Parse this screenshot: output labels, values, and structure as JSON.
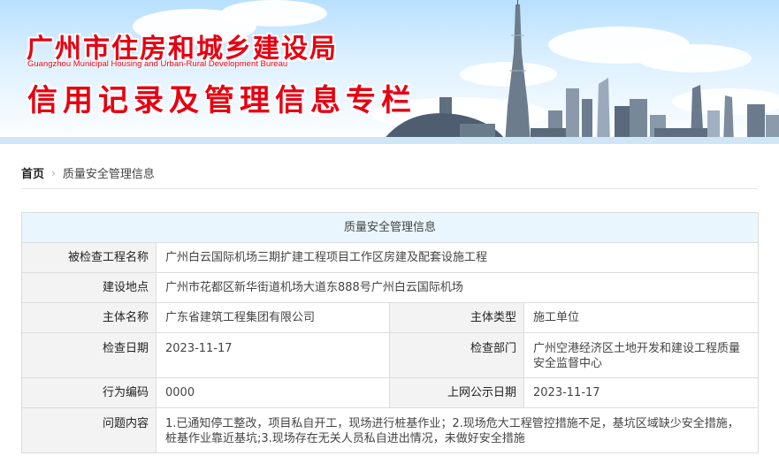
{
  "banner": {
    "title_cn": "广州市住房和城乡建设局",
    "title_en": "Guangzhou Municipal Housing and Urban-Rural Development Bureau",
    "subtitle": "信用记录及管理信息专栏",
    "accent_color": "#e60012"
  },
  "breadcrumb": {
    "home": "首页",
    "separator_icon": "chevron-right-icon",
    "current": "质量安全管理信息"
  },
  "table": {
    "header": "质量安全管理信息",
    "project_name_label": "被检查工程名称",
    "project_name": "广州白云国际机场三期扩建工程项目工作区房建及配套设施工程",
    "location_label": "建设地点",
    "location": "广州市花都区新华街道机场大道东888号广州白云国际机场",
    "entity_name_label": "主体名称",
    "entity_name": "广东省建筑工程集团有限公司",
    "entity_type_label": "主体类型",
    "entity_type": "施工单位",
    "check_date_label": "检查日期",
    "check_date": "2023-11-17",
    "check_dept_label": "检查部门",
    "check_dept": "广州空港经济区土地开发和建设工程质量安全监督中心",
    "behavior_code_label": "行为编码",
    "behavior_code": "0000",
    "publish_date_label": "上网公示日期",
    "publish_date": "2023-11-17",
    "issue_label": "问题内容",
    "issue": "1.已通知停工整改，项目私自开工，现场进行桩基作业；2.现场危大工程管控措施不足，基坑区域缺少安全措施，桩基作业靠近基坑;3.现场存在无关人员私自进出情况，未做好安全措施"
  }
}
